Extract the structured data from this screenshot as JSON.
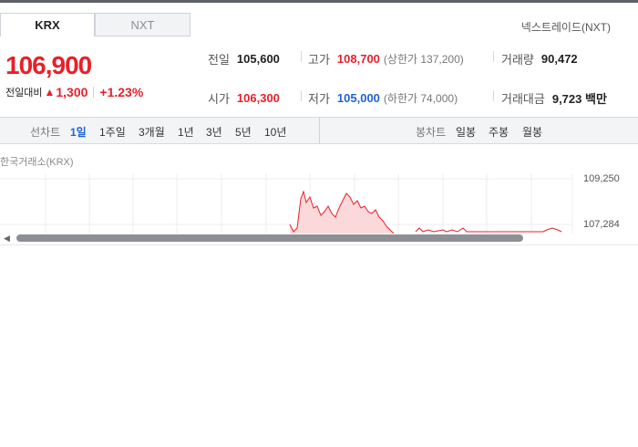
{
  "markets": {
    "tabs": [
      {
        "label": "KRX",
        "active": true
      },
      {
        "label": "NXT",
        "active": false
      }
    ],
    "nxt_link": "넥스트레이드(NXT)"
  },
  "quote": {
    "price": "106,900",
    "change_label": "전일대비",
    "change_arrow": "▲",
    "change_value": "1,300",
    "change_percent": "+1.23%",
    "stats": {
      "prev_close": {
        "label": "전일",
        "value": "105,600"
      },
      "high": {
        "label": "고가",
        "value": "108,700",
        "sub": "(상한가 137,200)"
      },
      "volume": {
        "label": "거래량",
        "value": "90,472"
      },
      "open": {
        "label": "시가",
        "value": "106,300"
      },
      "low": {
        "label": "저가",
        "value": "105,000",
        "sub": "(하한가 74,000)"
      },
      "turnover": {
        "label": "거래대금",
        "value": "9,723 백만"
      }
    }
  },
  "chart_toolbar": {
    "line_label": "선차트",
    "line_periods": [
      "1일",
      "1주일",
      "3개월",
      "1년",
      "3년",
      "5년",
      "10년"
    ],
    "active_period": "1일",
    "candle_label": "봉차트",
    "candle_periods": [
      "일봉",
      "주봉",
      "월봉"
    ]
  },
  "chart": {
    "source": "한국거래소(KRX)",
    "y_ticks": [
      "109,250",
      "107,284"
    ],
    "line_color": "#e8202a",
    "fill_color": "#fbd9da"
  },
  "colors": {
    "up": "#e8202a",
    "down": "#1f63d4"
  }
}
